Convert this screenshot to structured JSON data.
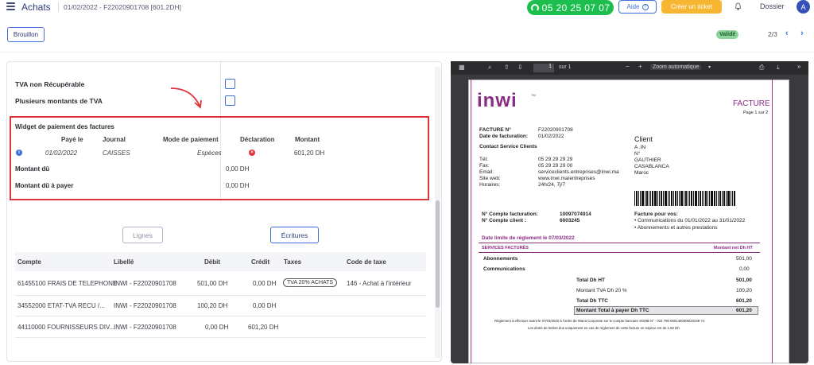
{
  "header": {
    "app_title": "Achats",
    "doc_ref": "01/02/2022 - F22020901708 [601.2DH]",
    "phone": "05 20 25 07 07",
    "aide": "Aide",
    "ticket": "Créer un ticket",
    "dossier": "Dossier",
    "avatar": "A"
  },
  "status": {
    "brouillon": "Brouillon",
    "valide": "Validé",
    "pager": "2/3"
  },
  "form": {
    "tva_nr": "TVA non Récupérable",
    "multi_tva": "Plusieurs montants de TVA",
    "widget_title": "Widget de paiement des factures",
    "cols": [
      "Payé le",
      "Journal",
      "Mode de paiement",
      "Déclaration",
      "Montant"
    ],
    "row": {
      "date": "01/02/2022",
      "journal": "CAISSES",
      "mode": "Espèces",
      "montant": "601,20 DH"
    },
    "montant_du": "Montant dû",
    "montant_du_val": "0,00 DH",
    "montant_du_payer": "Montant dû à payer",
    "montant_du_payer_val": "0,00 DH"
  },
  "buttons": {
    "lignes": "Lignes",
    "ecritures": "Écritures"
  },
  "table": {
    "headers": [
      "Compte",
      "Libellé",
      "Débit",
      "Crédit",
      "Taxes",
      "Code de taxe"
    ],
    "rows": [
      {
        "compte": "61455100 FRAIS DE TELEPHONE",
        "libelle": "INWI - F22020901708",
        "debit": "501,00 DH",
        "credit": "0,00 DH",
        "taxes": "TVA 20% ACHATS",
        "code": "146 - Achat à l'intérieur"
      },
      {
        "compte": "34552000 ETAT-TVA RECU /...",
        "libelle": "INWI - F22020901708",
        "debit": "100,20 DH",
        "credit": "0,00 DH",
        "taxes": "",
        "code": ""
      },
      {
        "compte": "44110000 FOURNISSEURS DIV...",
        "libelle": "INWI - F22020901708",
        "debit": "0,00 DH",
        "credit": "601,20 DH",
        "taxes": "",
        "code": ""
      }
    ]
  },
  "viewer": {
    "page_input": "1",
    "page_of": "sur 1",
    "zoom": "Zoom automatique"
  },
  "pdf": {
    "logo": "inwi",
    "logo_tm": "TM",
    "facture": "FACTURE",
    "page": "Page 1 sur 2",
    "fact_no_l": "FACTURE N°",
    "fact_no": "F22020901708",
    "date_fact_l": "Date de facturation:",
    "date_fact": "01/02/2022",
    "contact": "Contact Service Clients",
    "tel_l": "Tél:",
    "tel": "05 29 29 29 29",
    "fax_l": "Fax:",
    "fax": "05 29 29 29 00",
    "email_l": "Email:",
    "email": "serviceclients.entreprises@inwi.ma",
    "site_l": "Site web:",
    "site": "www.inwi.ma/entreprises",
    "hor_l": "Horaires:",
    "hor": "24h/24, 7j/7",
    "client": "Client",
    "client_lines": [
      "A                                         .IN",
      "N°",
      "GAUTHIER",
      "CASABLANCA",
      "Maroc"
    ],
    "ncf_l": "N° Compte facturation:",
    "ncf": "10097074914",
    "ncc_l": "N° Compte client :",
    "ncc": "6003245",
    "fpv": "Facture pour vos:",
    "fpv1": "• Communications du 01/01/2022 au 31/01/2022",
    "fpv2": "• Abonnements et autres prestations",
    "dlr": "Date limite de règlement  le 07/03/2022",
    "sf": "SERVICES FACTURÉS",
    "mnet": "Montant net Dh HT",
    "abo": "Abonnements",
    "abo_v": "501,00",
    "com": "Communications",
    "com_v": "0,00",
    "tht": "Total Dh HT",
    "tht_v": "501,00",
    "mtva": "Montant TVA Dh 20 %",
    "mtva_v": "100,20",
    "tttc": "Total Dh TTC",
    "tttc_v": "601,20",
    "mtot": "Montant Total à payer Dh TTC",
    "mtot_v": "601,20",
    "foot1": "Règlement à effectuer avant le 07/03/2022 à l'ordre de Wana Corporate sur le compte bancaire SGMB N° : 022 780 0001400005/20238 74",
    "foot2": "Les droits de timbre dus uniquement en cas de règlement de cette facture en espèce est de 1,50 Dh"
  }
}
